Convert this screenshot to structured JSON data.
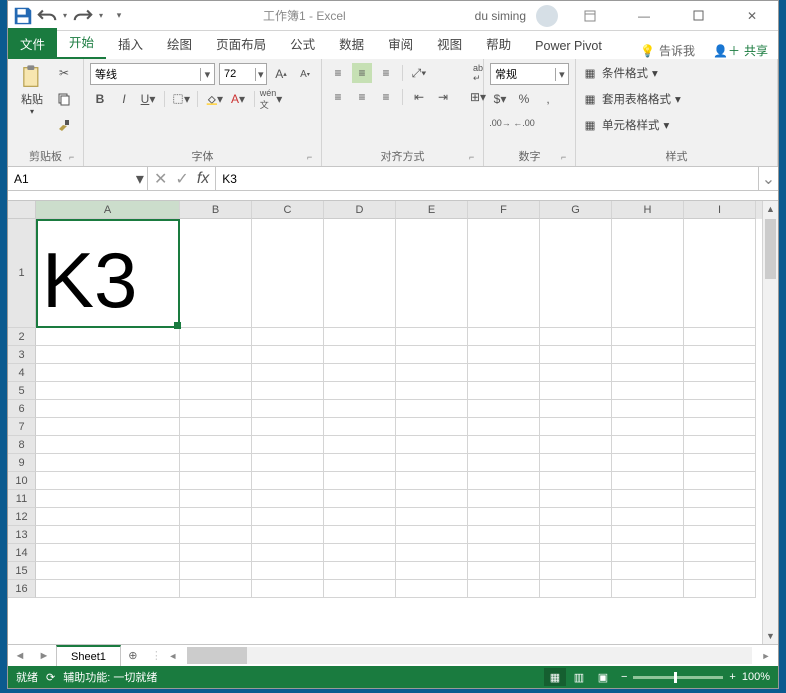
{
  "title": {
    "doc": "工作簿1",
    "app": "Excel",
    "user": "du siming"
  },
  "tabs": {
    "file": "文件",
    "home": "开始",
    "insert": "插入",
    "draw": "绘图",
    "layout": "页面布局",
    "formulas": "公式",
    "data": "数据",
    "review": "审阅",
    "view": "视图",
    "help": "帮助",
    "powerpivot": "Power Pivot",
    "tellme": "告诉我",
    "share": "共享"
  },
  "ribbon": {
    "paste": "粘贴",
    "clipboard": "剪贴板",
    "font_name": "等线",
    "font_size": "72",
    "font": "字体",
    "alignment": "对齐方式",
    "number_format": "常规",
    "number": "数字",
    "cond_format": "条件格式",
    "table_format": "套用表格格式",
    "cell_style": "单元格样式",
    "styles": "样式"
  },
  "formula": {
    "namebox": "A1",
    "value": "K3"
  },
  "columns": [
    "A",
    "B",
    "C",
    "D",
    "E",
    "F",
    "G",
    "H",
    "I"
  ],
  "row_heights": {
    "first": 109,
    "rest": 18
  },
  "row_count": 16,
  "cell_a1": "K3",
  "sheet": {
    "name": "Sheet1"
  },
  "status": {
    "ready": "就绪",
    "access": "辅助功能: 一切就绪",
    "zoom": "100%"
  }
}
